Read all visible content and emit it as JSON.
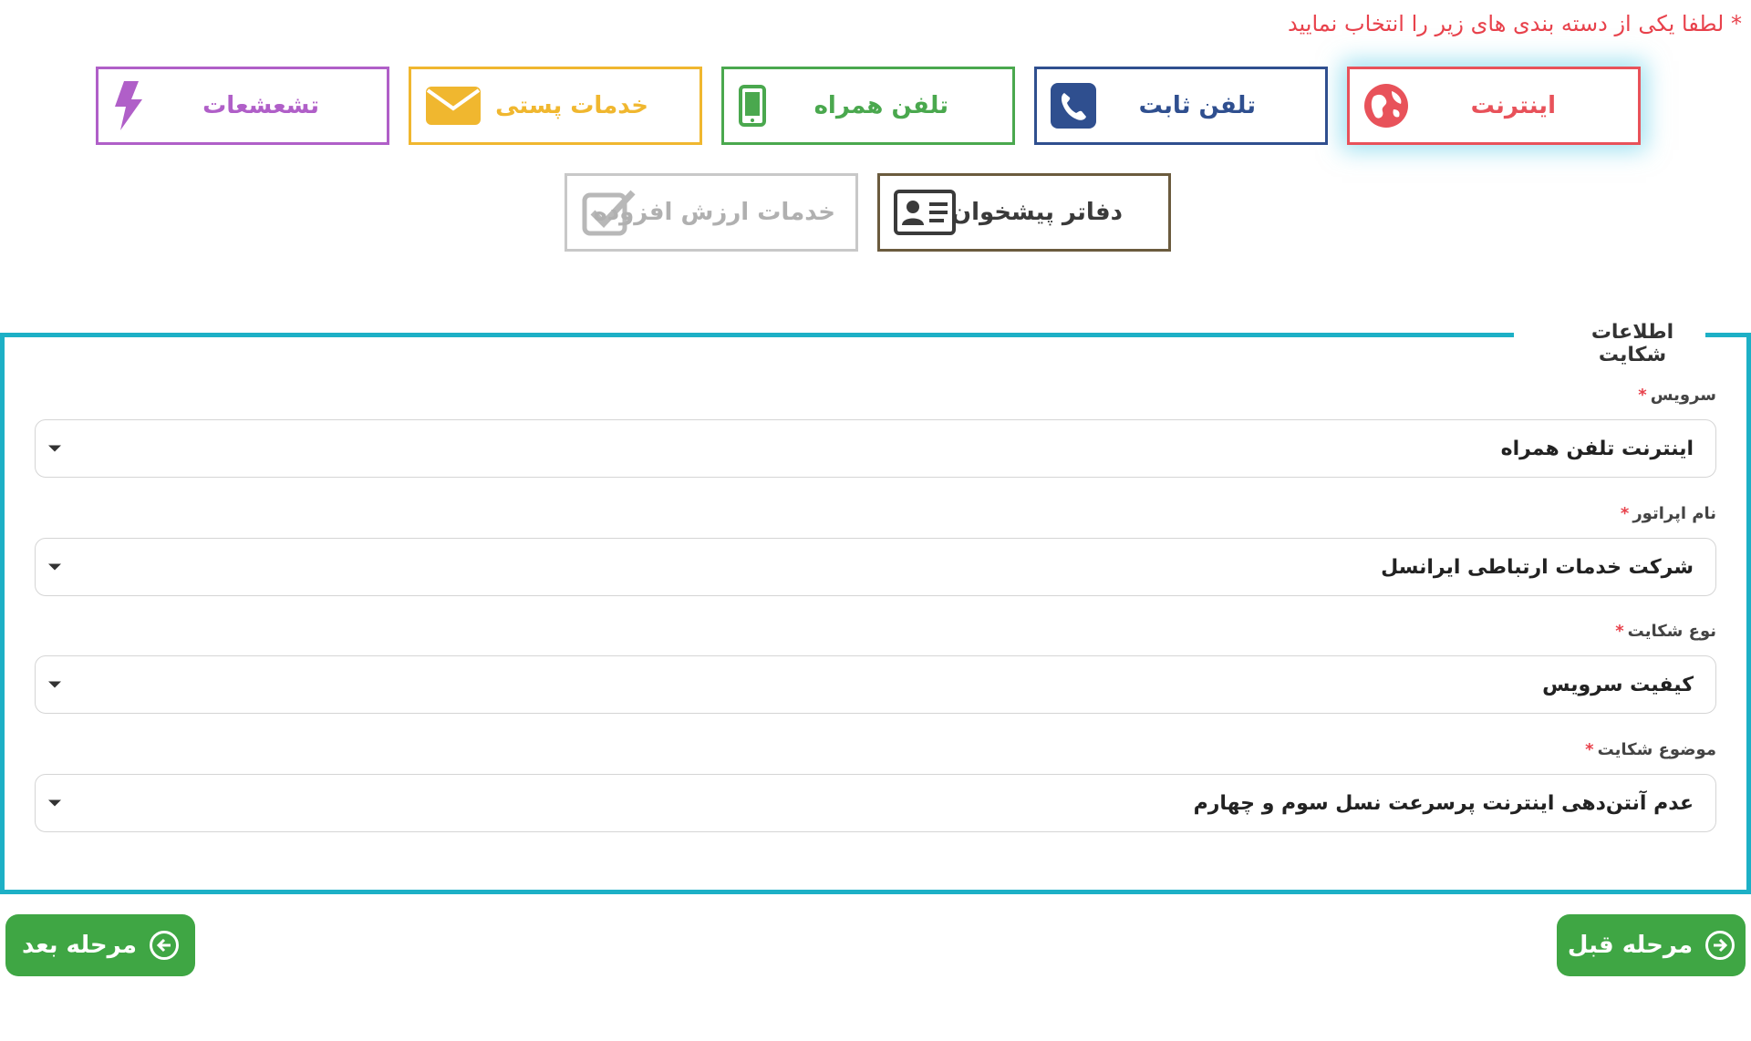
{
  "instruction": "* لطفا یکی از دسته بندی های زیر را انتخاب نمایید",
  "categories": [
    {
      "label": "اینترنت",
      "icon": "globe-icon",
      "color": "#e8525a"
    },
    {
      "label": "تلفن ثابت",
      "icon": "phone-icon",
      "color": "#2f4f8f"
    },
    {
      "label": "تلفن همراه",
      "icon": "mobile-icon",
      "color": "#4aa84e"
    },
    {
      "label": "خدمات پستی",
      "icon": "envelope-icon",
      "color": "#f0b72f"
    },
    {
      "label": "تشعشعات",
      "icon": "lightning-icon",
      "color": "#b05fc8"
    },
    {
      "label": "دفاتر پیشخوان",
      "icon": "id-card-icon",
      "color": "#6b5b3e"
    },
    {
      "label": "خدمات ارزش افزوده",
      "icon": "checkbox-icon",
      "color": "#b8b8b8"
    }
  ],
  "form": {
    "legend": "اطلاعات شکایت",
    "fields": [
      {
        "label": "سرویس",
        "required": "*",
        "value": "اینترنت تلفن همراه"
      },
      {
        "label": "نام اپراتور",
        "required": "*",
        "value": "شرکت خدمات ارتباطی ایرانسل"
      },
      {
        "label": "نوع شکایت",
        "required": "*",
        "value": "کیفیت سرویس"
      },
      {
        "label": "موضوع شکایت",
        "required": "*",
        "value": "عدم آنتن‌دهی اینترنت پرسرعت نسل سوم و چهارم"
      }
    ]
  },
  "buttons": {
    "next": "مرحله بعد",
    "prev": "مرحله قبل"
  }
}
